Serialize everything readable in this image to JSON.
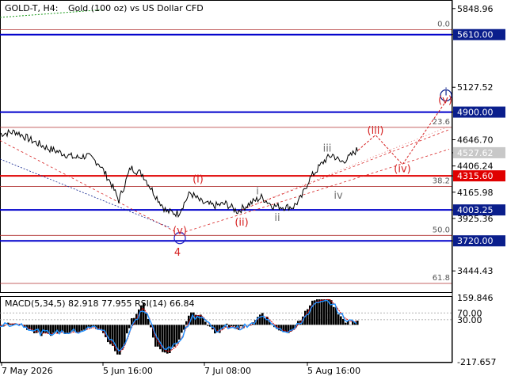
{
  "header": {
    "symbol": "GOLD-T, H4:",
    "description": "Gold (100 oz) vs US Dollar CFD"
  },
  "colors": {
    "background": "#ffffff",
    "price_line": "#000000",
    "blue_level": "#0000cc",
    "red_level": "#e00000",
    "fib_line": "#b03030",
    "wave_red": "#d62020",
    "wave_gray": "#707070",
    "wave_label_4": "#e00000",
    "circle": "#2020c0",
    "badge_blue": "#0a1e8c",
    "badge_red": "#e00000",
    "badge_gray": "#c8c8c8",
    "macd_hist": "#000000",
    "macd_signal": "#e00000",
    "rsi": "#1e90ff",
    "ma_green": "#1a9a1a"
  },
  "price_axis": {
    "ticks": [
      "5848.96",
      "5610.00",
      "5127.52",
      "4900.00",
      "4646.70",
      "4527.62",
      "4406.24",
      "4315.60",
      "4165.98",
      "4003.25",
      "3925.36",
      "3720.00",
      "3444.43"
    ],
    "range": [
      3250,
      5920
    ]
  },
  "badges": [
    {
      "label": "5610.00",
      "value": 5610.0,
      "style": "blue"
    },
    {
      "label": "4900.00",
      "value": 4900.0,
      "style": "blue"
    },
    {
      "label": "4527.62",
      "value": 4527.62,
      "style": "gray"
    },
    {
      "label": "4315.60",
      "value": 4315.6,
      "style": "red"
    },
    {
      "label": "4003.25",
      "value": 4003.25,
      "style": "blue"
    },
    {
      "label": "3720.00",
      "value": 3720.0,
      "style": "blue"
    }
  ],
  "levels": [
    {
      "value": 5610.0,
      "kind": "blue"
    },
    {
      "value": 4900.0,
      "kind": "blue"
    },
    {
      "value": 4315.6,
      "kind": "red"
    },
    {
      "value": 4003.25,
      "kind": "blue"
    },
    {
      "value": 3720.0,
      "kind": "blue"
    }
  ],
  "fib_levels": [
    {
      "label": "0.0",
      "value": 5656
    },
    {
      "label": "23.6",
      "value": 4760
    },
    {
      "label": "38.2",
      "value": 4218
    },
    {
      "label": "50.0",
      "value": 3770
    },
    {
      "label": "61.8",
      "value": 3330
    }
  ],
  "wave_labels": [
    {
      "text": "(i)",
      "bar": 250,
      "value": 4255,
      "color": "red"
    },
    {
      "text": "(ii)",
      "bar": 305,
      "value": 3860,
      "color": "red"
    },
    {
      "text": "(iii)",
      "bar": 474,
      "value": 4700,
      "color": "red"
    },
    {
      "text": "(iv)",
      "bar": 508,
      "value": 4350,
      "color": "red"
    },
    {
      "text": "(v)",
      "bar": 562,
      "value": 4980,
      "color": "red"
    },
    {
      "text": "(v)",
      "bar": 227,
      "value": 3782,
      "color": "red"
    },
    {
      "text": "4",
      "bar": 224,
      "value": 3582,
      "color": "red"
    },
    {
      "text": "i",
      "bar": 325,
      "value": 4145,
      "color": "gray"
    },
    {
      "text": "ii",
      "bar": 350,
      "value": 3902,
      "color": "gray"
    },
    {
      "text": "iii",
      "bar": 413,
      "value": 4537,
      "color": "gray"
    },
    {
      "text": "iv",
      "bar": 427,
      "value": 4107,
      "color": "gray"
    },
    {
      "text": "i",
      "bar": 563,
      "value": 5053,
      "color": "navy"
    }
  ],
  "chart_data": {
    "type": "line",
    "title": "GOLD-T, H4: Gold (100 oz) vs US Dollar CFD",
    "x_ticks": [
      "7 May 2026",
      "5 Jun 16:00",
      "7 Jul 08:00",
      "5 Aug 16:00"
    ],
    "ylim": [
      3250,
      5920
    ],
    "close_series_approx": {
      "bars": [
        0,
        20,
        40,
        60,
        80,
        95,
        110,
        125,
        140,
        150,
        165,
        180,
        195,
        210,
        225,
        240,
        255,
        270,
        285,
        300,
        315,
        330,
        345,
        360,
        370,
        380,
        390,
        400,
        410,
        420,
        430,
        440,
        450
      ],
      "values": [
        4700,
        4720,
        4640,
        4570,
        4520,
        4480,
        4500,
        4430,
        4250,
        4090,
        4390,
        4330,
        4150,
        3990,
        3970,
        4160,
        4070,
        4040,
        4060,
        3990,
        4060,
        4120,
        4040,
        4030,
        4030,
        4110,
        4280,
        4370,
        4460,
        4510,
        4440,
        4480,
        4550
      ]
    },
    "forecast_path": {
      "bars": [
        452,
        474,
        508,
        562
      ],
      "values": [
        4550,
        4690,
        4420,
        4990
      ]
    },
    "indicator": {
      "label": "MACD(5,34,5) 82.918 77.955 RSI(14) 66.84",
      "macd_main": 82.918,
      "macd_signal": 77.955,
      "rsi": 66.84,
      "ticks": [
        "159.846",
        "70.00",
        "30.00",
        "-217.657"
      ],
      "range": [
        -217.657,
        159.846
      ]
    }
  }
}
